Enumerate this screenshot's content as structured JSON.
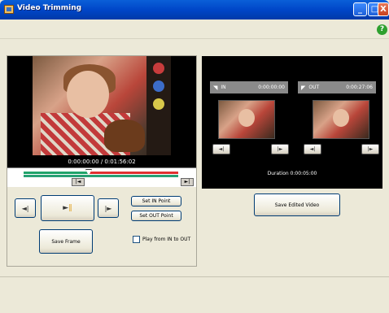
{
  "window": {
    "title": "Video Trimming",
    "minimize": "_",
    "maximize": "□",
    "close": "X",
    "help": "?"
  },
  "preview": {
    "timecode": "0:00:00:00 / 0:01:56:02"
  },
  "track": {
    "left_marker": "|◄",
    "right_marker": "►|"
  },
  "controls": {
    "prev_glyph": "◄|",
    "play_glyph": "►",
    "pause_glyph": "‖",
    "next_glyph": "|►",
    "set_in": "Set IN Point",
    "set_out": "Set OUT Point",
    "save_frame": "Save Frame",
    "play_from_in_to_out": "Play from IN to OUT"
  },
  "in_point": {
    "label": "IN",
    "time": "0:00:00:00",
    "flag": "◥",
    "btn_back": "◄|",
    "btn_forward": "|►"
  },
  "out_point": {
    "label": "OUT",
    "time": "0:00:27:06",
    "flag": "◤",
    "btn_back": "◄|",
    "btn_forward": "|►"
  },
  "duration": "Duration 0:00:05:00",
  "save_edited": "Save Edited Video",
  "colors": {
    "titlebar": "#0046c8",
    "track_green": "#1fa36a",
    "track_red": "#e03030",
    "help": "#2ea02e"
  }
}
